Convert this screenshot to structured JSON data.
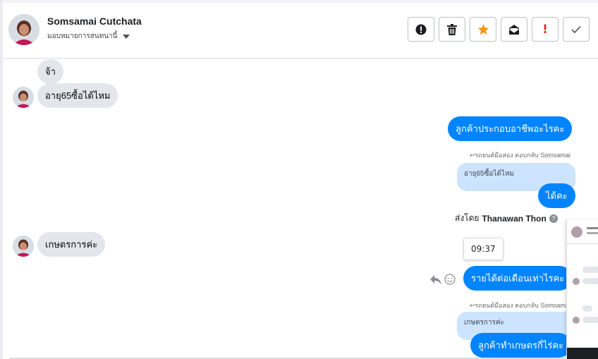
{
  "header": {
    "contact_name": "Somsamai Cutchata",
    "assign_label": "มอบหมายการสนทนานี้",
    "toolbar": [
      {
        "icon": "alert-circle-icon"
      },
      {
        "icon": "trash-icon"
      },
      {
        "icon": "star-icon"
      },
      {
        "icon": "mark-unread-icon"
      },
      {
        "icon": "exclamation-icon"
      },
      {
        "icon": "check-icon"
      }
    ]
  },
  "messages": {
    "in_1": "จ้า",
    "in_2": "อายุ65ซื้อได้ไหม",
    "out_1": "ลูกค้าประกอบอาชีพอะไรคะ",
    "reply_meta_1": "รถยนต์มือสอง ตอบกลับ Somsamai",
    "quoted_1": "อายุ65ซื้อได้ไหม",
    "out_2": "ได้คะ",
    "sent_by_prefix": "ส่งโดย",
    "sent_by_name": "Thanawan Thon",
    "in_3": "เกษตรการค่ะ",
    "time_tooltip": "09:37",
    "out_3": "รายได้ต่อเดือนเท่าไรคะ",
    "reply_meta_2": "รถยนต์มือสอง ตอบกลับ Somsamai",
    "quoted_2": "เกษตรการค่ะ",
    "out_4": "ลูกค้าทำเกษตรกี่ไร่คะ"
  },
  "colors": {
    "outgoing": "#0084ff",
    "incoming": "#e4e6eb",
    "quoted": "#cce4ff",
    "star": "#f7931e",
    "exclamation": "#e02c2c"
  }
}
